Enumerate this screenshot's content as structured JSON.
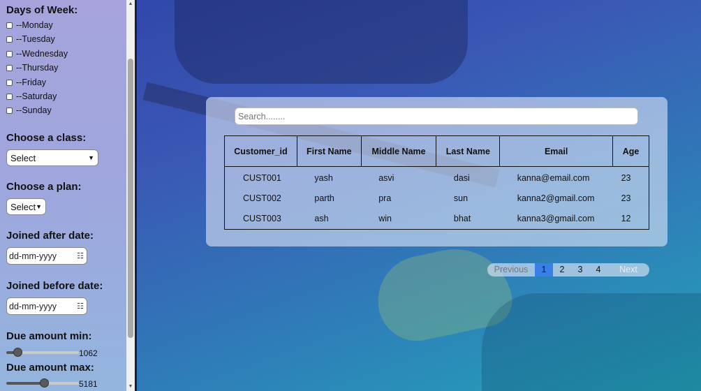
{
  "sidebar": {
    "days_title": "Days of Week:",
    "days": [
      "--Monday",
      "--Tuesday",
      "--Wednesday",
      "--Thursday",
      "--Friday",
      "--Saturday",
      "--Sunday"
    ],
    "class_title": "Choose a class:",
    "class_select": "Select",
    "plan_title": "Choose a plan:",
    "plan_select": "Select",
    "joined_after_title": "Joined after date:",
    "joined_after_placeholder": "dd-mm-yyyy",
    "joined_before_title": "Joined before date:",
    "joined_before_placeholder": "dd-mm-yyyy",
    "due_min_title": "Due amount min:",
    "due_min_value": "1062",
    "due_max_title": "Due amount max:",
    "due_max_value": "5181"
  },
  "search": {
    "placeholder": "Search........"
  },
  "table": {
    "headers": [
      "Customer_id",
      "First Name",
      "Middle Name",
      "Last Name",
      "Email",
      "Age"
    ],
    "rows": [
      [
        "CUST001",
        "yash",
        "asvi",
        "dasi",
        "kanna@email.com",
        "23"
      ],
      [
        "CUST002",
        "parth",
        "pra",
        "sun",
        "kanna2@gmail.com",
        "23"
      ],
      [
        "CUST003",
        "ash",
        "win",
        "bhat",
        "kanna3@gmail.com",
        "12"
      ]
    ]
  },
  "pagination": {
    "previous": "Previous",
    "pages": [
      "1",
      "2",
      "3",
      "4"
    ],
    "active": "1",
    "next": "Next"
  },
  "colors": {
    "active_page": "#3a7ee8"
  },
  "icons": {
    "calendar": "calendar-icon",
    "dropdown": "chevron-down-icon"
  }
}
